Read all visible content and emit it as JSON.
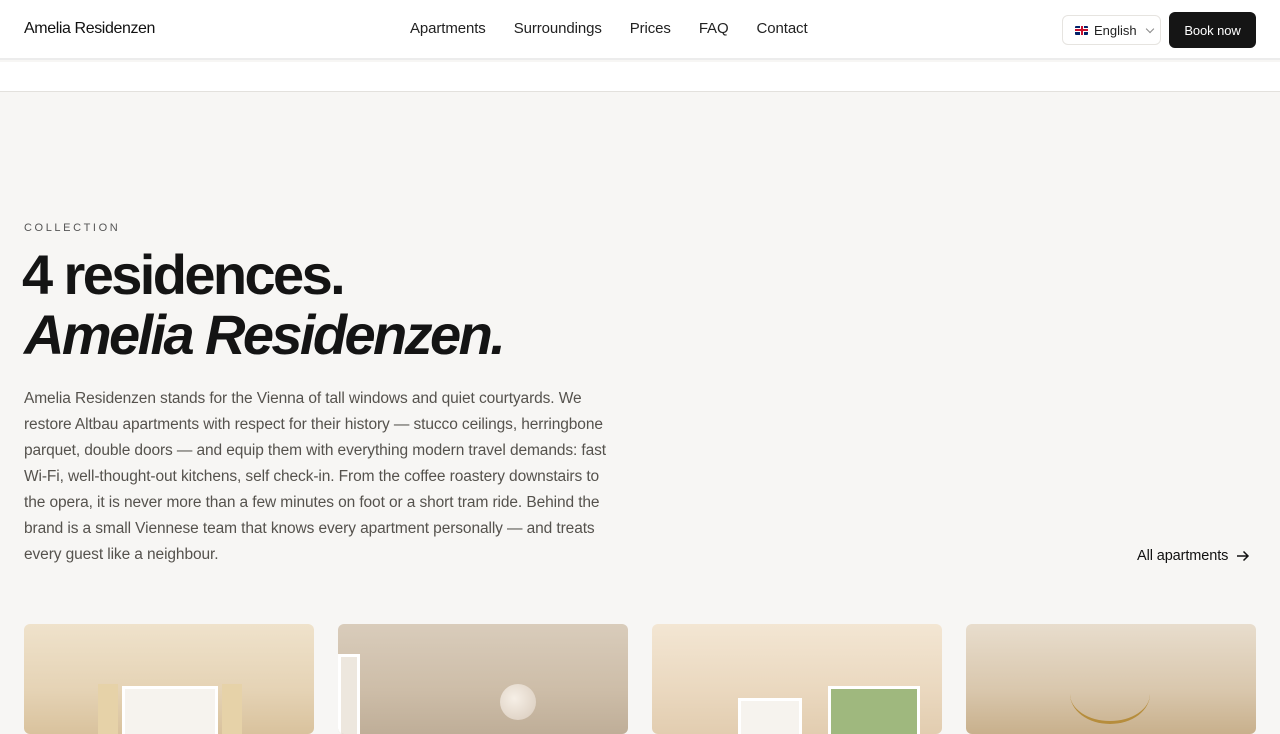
{
  "header": {
    "brand": "Amelia Residenzen",
    "nav": [
      "Apartments",
      "Surroundings",
      "Prices",
      "FAQ",
      "Contact"
    ],
    "language": "English",
    "book_label": "Book now"
  },
  "hero": {
    "eyebrow": "COLLECTION",
    "title_line1": "4 residences.",
    "title_line2": "Amelia Residenzen.",
    "description": "Amelia Residenzen stands for the Vienna of tall windows and quiet courtyards. We restore Altbau apartments with respect for their history — stucco ceilings, herringbone parquet, double doors — and equip them with everything modern travel demands: fast Wi-Fi, well-thought-out kitchens, self check-in. From the coffee roastery downstairs to the opera, it is never more than a few minutes on foot or a short tram ride. Behind the brand is a small Viennese team that knows every apartment personally — and treats every guest like a neighbour.",
    "all_apartments_label": "All apartments"
  },
  "icons": {
    "flag": "uk-flag-icon",
    "chevron": "chevron-down-icon",
    "arrow": "arrow-right-icon"
  },
  "colors": {
    "background": "#f7f6f4",
    "button_dark": "#151515",
    "text_primary": "#141414",
    "text_muted": "#55524d"
  }
}
